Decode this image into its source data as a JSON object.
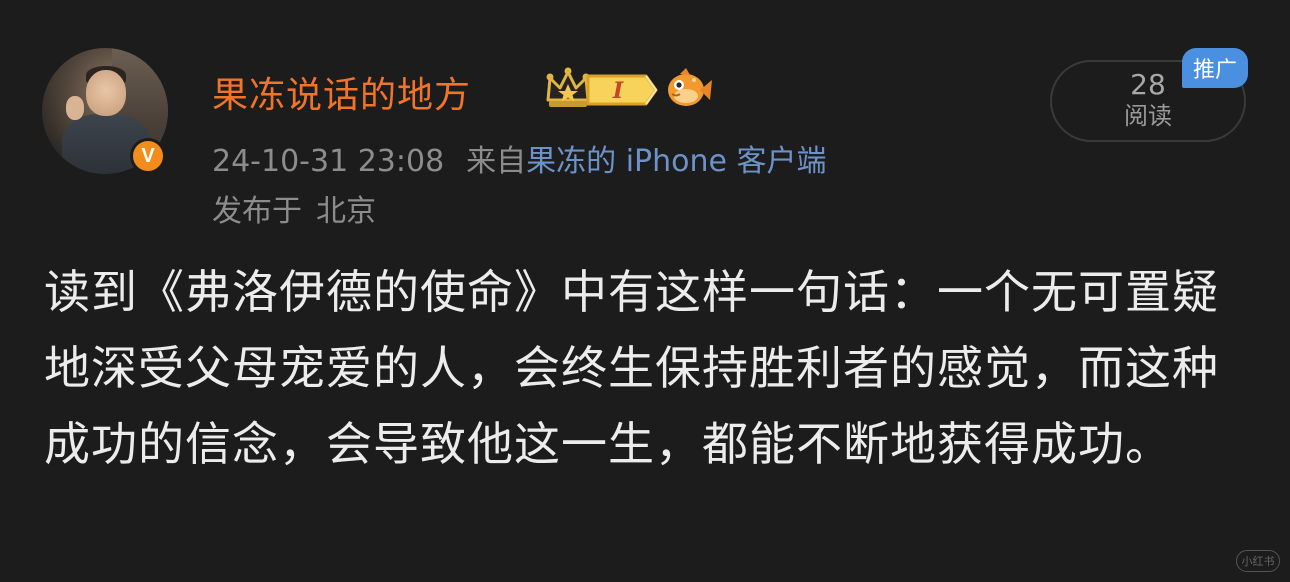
{
  "user": {
    "name": "果冻说话的地方",
    "verified_mark": "V",
    "level_badge": "I"
  },
  "meta": {
    "timestamp": "24-10-31 23:08",
    "from_label": "来自",
    "client": "果冻的 iPhone 客户端",
    "location_label": "发布于",
    "location": "北京"
  },
  "stats": {
    "read_count": "28",
    "read_label": "阅读",
    "promo_tag": "推广"
  },
  "post": {
    "text": "读到《弗洛伊德的使命》中有这样一句话：一个无可置疑地深受父母宠爱的人，会终生保持胜利者的感觉，而这种成功的信念，会导致他这一生，都能不断地获得成功。"
  },
  "watermark": "小红书",
  "colors": {
    "background": "#1c1c1c",
    "username": "#f0742a",
    "meta": "#8c8c8c",
    "client_link": "#6d92c8",
    "promo": "#4a8fe0",
    "verified": "#f28c1a",
    "text": "#ececec"
  },
  "icons": [
    "crown-icon",
    "level-badge-icon",
    "fish-icon",
    "verified-icon"
  ]
}
